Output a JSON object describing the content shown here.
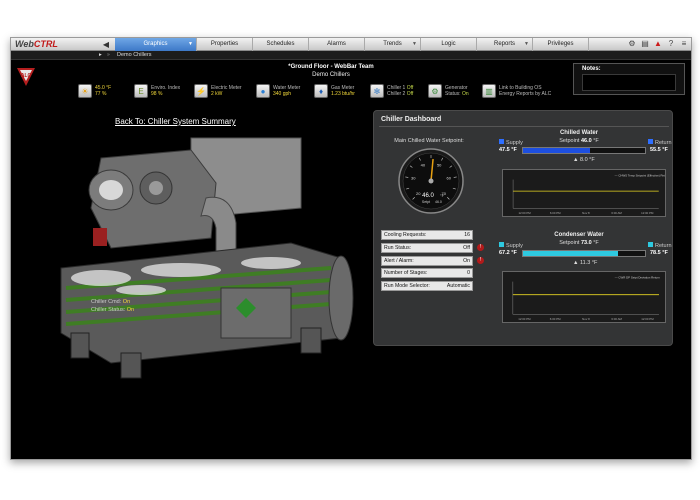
{
  "app": {
    "logo_a": "Web",
    "logo_b": "CTRL"
  },
  "nav": {
    "tabs": [
      {
        "label": "Graphics",
        "active": true
      },
      {
        "label": "Properties"
      },
      {
        "label": "Schedules"
      },
      {
        "label": "Alarms"
      },
      {
        "label": "Trends"
      },
      {
        "label": "Logic"
      },
      {
        "label": "Reports"
      },
      {
        "label": "Privileges"
      }
    ]
  },
  "breadcrumb": {
    "current": "Demo Chillers"
  },
  "header": {
    "floor_title": "*Ground Floor - WebBar Team",
    "subtitle": "Demo Chillers",
    "notes_label": "Notes:"
  },
  "metrics": [
    {
      "icon": "sun-icon",
      "lines": [
        "45.0 °F",
        "77 %"
      ],
      "kind": "weather"
    },
    {
      "label": "Enviro. Index",
      "value": "98 %",
      "icon": "enviro-index-icon"
    },
    {
      "label": "Electric Meter",
      "value": "2 kW",
      "icon": "lightning-icon"
    },
    {
      "label": "Water Meter",
      "value": "340 gph",
      "icon": "water-drop-icon"
    },
    {
      "label": "Gas Meter",
      "value": "1.23 btu/hr",
      "icon": "flame-icon"
    },
    {
      "label": "Chiller 1",
      "value": "Off",
      "label2": "Chiller 2",
      "value2": "Off",
      "icon": "snowflake-icon"
    },
    {
      "label": "Generator",
      "label2": "Status:",
      "value2": "On",
      "icon": "generator-icon"
    },
    {
      "label": "Link to Building OS",
      "label2": "Energy Reports by ALC",
      "icon": "energy-report-icon"
    }
  ],
  "back_link": "Back To: Chiller System Summary",
  "chiller_caption": {
    "cmd_label": "Chiller Cmd:",
    "cmd_value": "On",
    "status_label": "Chiller Status:",
    "status_value": "On"
  },
  "dashboard": {
    "title": "Chiller Dashboard",
    "gauge": {
      "title": "Main Chilled Water Setpoint:",
      "value": "46.0",
      "unit": "°F",
      "setpt_label": "Setpt",
      "setpt_value": "46.0",
      "min": 20,
      "max": 70,
      "ticks": [
        "20",
        "25",
        "30",
        "35",
        "40",
        "45",
        "50",
        "55",
        "60",
        "65",
        "70"
      ]
    },
    "status": [
      {
        "label": "Cooling Requests:",
        "value": "16"
      },
      {
        "label": "Run Status:",
        "value": "Off",
        "alarm": true
      },
      {
        "label": "Alert / Alarm:",
        "value": "On",
        "alarm": true
      },
      {
        "label": "Number of Stages:",
        "value": "0"
      },
      {
        "label": "Run Mode Selector:",
        "value": "Automatic"
      }
    ],
    "chilled": {
      "title": "Chilled Water",
      "setpoint_label": "Setpoint",
      "setpoint_value": "46.0",
      "setpoint_unit": "°F",
      "supply_label": "Supply",
      "supply_value": "47.5",
      "supply_unit": "°F",
      "return_label": "Return",
      "return_value": "55.5",
      "return_unit": "°F",
      "fill_fraction": 0.55,
      "fill_color": "#1d4fe0",
      "swatch_supply": "#2f6fff",
      "swatch_return": "#2f6fff",
      "delta_value": "8.0",
      "delta_unit": "°F",
      "legend1": "CHWS Temp Setpoint (Effective)",
      "legend2": "Return",
      "x_labels": [
        "12:00 PM",
        "6:00 PM",
        "Nov 8",
        "6:00 AM",
        "12:00 PM"
      ]
    },
    "condenser": {
      "title": "Condenser Water",
      "setpoint_label": "Setpoint",
      "setpoint_value": "73.0",
      "setpoint_unit": "°F",
      "supply_label": "Supply",
      "supply_value": "67.2",
      "supply_unit": "°F",
      "return_label": "Return",
      "return_value": "78.5",
      "return_unit": "°F",
      "fill_fraction": 0.78,
      "fill_color": "#2ec9e0",
      "swatch_supply": "#2ec9e0",
      "swatch_return": "#2ec9e0",
      "delta_value": "11.3",
      "delta_unit": "°F",
      "legend1": "CWR DP Setpt Deviation",
      "legend2": "Return",
      "x_labels": [
        "12:00 PM",
        "6:00 PM",
        "Nov 8",
        "6:00 AM",
        "12:00 PM"
      ]
    }
  }
}
